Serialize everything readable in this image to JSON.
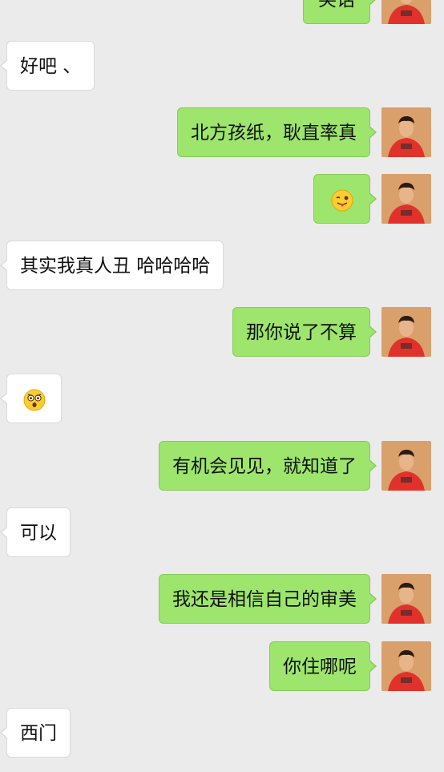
{
  "colors": {
    "background": "#ebebeb",
    "sent_bubble": "#9de56c",
    "received_bubble": "#ffffff"
  },
  "messages": [
    {
      "side": "sent",
      "type": "text",
      "text": "笑话",
      "partial": true
    },
    {
      "side": "received",
      "type": "text",
      "text": "好吧 、"
    },
    {
      "side": "sent",
      "type": "text",
      "text": "北方孩纸，耿直率真"
    },
    {
      "side": "sent",
      "type": "emoji",
      "emoji": "winking-tongue-face-icon"
    },
    {
      "side": "received",
      "type": "text",
      "text": "其实我真人丑 哈哈哈哈"
    },
    {
      "side": "sent",
      "type": "text",
      "text": "那你说了不算"
    },
    {
      "side": "received",
      "type": "emoji",
      "emoji": "shocked-face-icon"
    },
    {
      "side": "sent",
      "type": "text",
      "text": "有机会见见，就知道了"
    },
    {
      "side": "received",
      "type": "text",
      "text": "可以"
    },
    {
      "side": "sent",
      "type": "text",
      "text": "我还是相信自己的审美"
    },
    {
      "side": "sent",
      "type": "text",
      "text": "你住哪呢"
    },
    {
      "side": "received",
      "type": "text",
      "text": "西门"
    }
  ]
}
